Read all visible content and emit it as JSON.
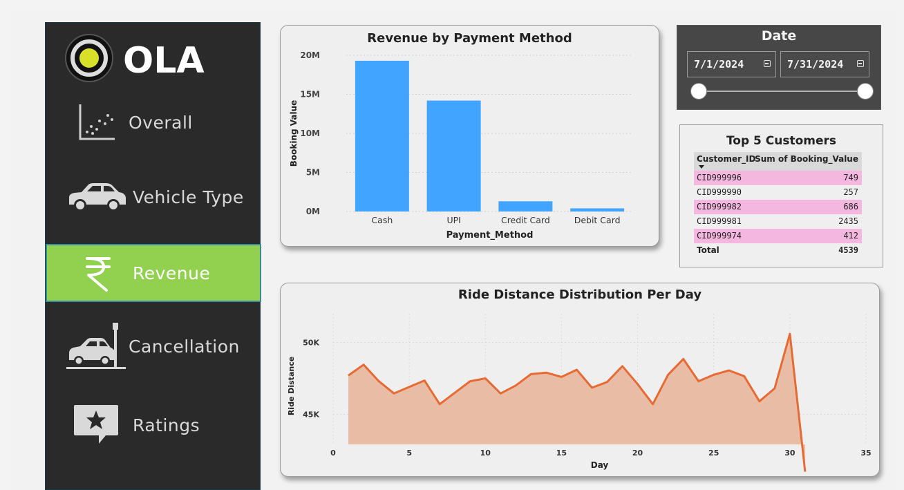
{
  "logo": {
    "text": "OLA"
  },
  "nav": [
    {
      "label": "Overall",
      "icon": "scatter-chart-icon",
      "active": false
    },
    {
      "label": "Vehicle Type",
      "icon": "car-icon",
      "active": false
    },
    {
      "label": "Revenue",
      "icon": "rupee-icon",
      "active": true
    },
    {
      "label": "Cancellation",
      "icon": "car-parking-icon",
      "active": false
    },
    {
      "label": "Ratings",
      "icon": "star-message-icon",
      "active": false
    }
  ],
  "date_slicer": {
    "title": "Date",
    "start": "7/1/2024",
    "end": "7/31/2024"
  },
  "top_customers": {
    "title": "Top 5 Customers",
    "columns": [
      "Customer_ID",
      "Sum of Booking_Value"
    ],
    "rows": [
      {
        "id": "CID999996",
        "value": "749"
      },
      {
        "id": "CID999990",
        "value": "257"
      },
      {
        "id": "CID999982",
        "value": "686"
      },
      {
        "id": "CID999981",
        "value": "2435"
      },
      {
        "id": "CID999974",
        "value": "412"
      }
    ],
    "total_label": "Total",
    "total_value": "4539",
    "highlight_color": "#f4b7e0"
  },
  "chart_data": [
    {
      "type": "bar",
      "title": "Revenue by Payment Method",
      "xlabel": "Payment_Method",
      "ylabel": "Booking Value",
      "categories": [
        "Cash",
        "UPI",
        "Credit Card",
        "Debit Card"
      ],
      "values": [
        19300000,
        14200000,
        1300000,
        400000
      ],
      "ylim": [
        0,
        20000000
      ],
      "yticks": [
        0,
        5000000,
        10000000,
        15000000,
        20000000
      ],
      "ytick_labels": [
        "0M",
        "5M",
        "10M",
        "15M",
        "20M"
      ],
      "color": "#41a5ff",
      "grid": true
    },
    {
      "type": "area",
      "title": "Ride Distance Distribution Per Day",
      "xlabel": "Day",
      "ylabel": "Ride Distance",
      "x": [
        1,
        2,
        3,
        4,
        5,
        6,
        7,
        8,
        9,
        10,
        11,
        12,
        13,
        14,
        15,
        16,
        17,
        18,
        19,
        20,
        21,
        22,
        23,
        24,
        25,
        26,
        27,
        28,
        29,
        30,
        31
      ],
      "values": [
        47700,
        48450,
        47300,
        46450,
        46900,
        47350,
        45700,
        46500,
        47300,
        47500,
        46450,
        47000,
        47800,
        47900,
        47600,
        48100,
        46850,
        47250,
        48350,
        47100,
        45700,
        47750,
        48850,
        47300,
        47750,
        48050,
        47650,
        45900,
        46800,
        50600,
        41000
      ],
      "xlim": [
        0,
        35
      ],
      "xticks": [
        0,
        5,
        10,
        15,
        20,
        25,
        30,
        35
      ],
      "ylim": [
        42900,
        52000
      ],
      "yticks": [
        45000,
        50000
      ],
      "ytick_labels": [
        "45K",
        "50K"
      ],
      "line_color": "#e66a33",
      "fill_color": "#e8b8a0",
      "grid": true
    }
  ]
}
